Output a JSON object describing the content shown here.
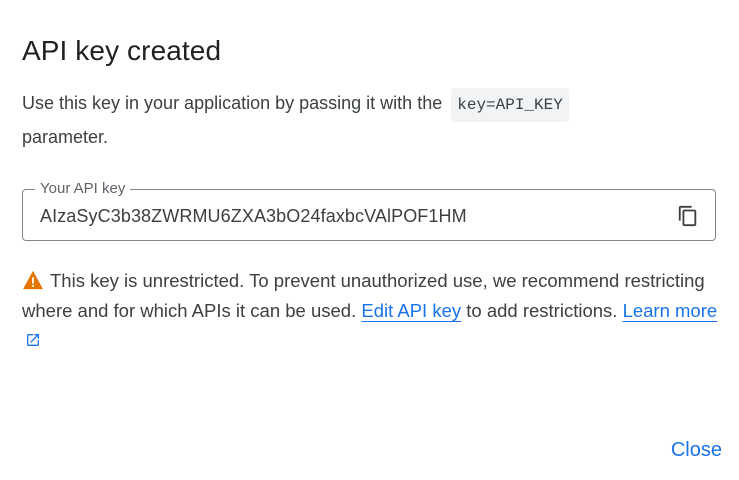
{
  "dialog": {
    "title": "API key created",
    "description_prefix": "Use this key in your application by passing it with the",
    "code_param": "key=API_KEY",
    "description_suffix": "parameter.",
    "field_label": "Your API key",
    "api_key": "AIzaSyC3b38ZWRMU6ZXA3bO24faxbcVAlPOF1HM",
    "copy_icon": "copy-icon",
    "warning_icon": "warning-icon",
    "warning_text_1": "This key is unrestricted. To prevent unauthorized use, we recommend restricting where and for which APIs it can be used.",
    "edit_link": "Edit API key",
    "warning_text_2": "to add restrictions.",
    "learn_more_link": "Learn more",
    "close_label": "Close"
  },
  "colors": {
    "link": "#1a73e8",
    "warning": "#e37400",
    "text": "#3c4043",
    "border": "#80868b"
  }
}
